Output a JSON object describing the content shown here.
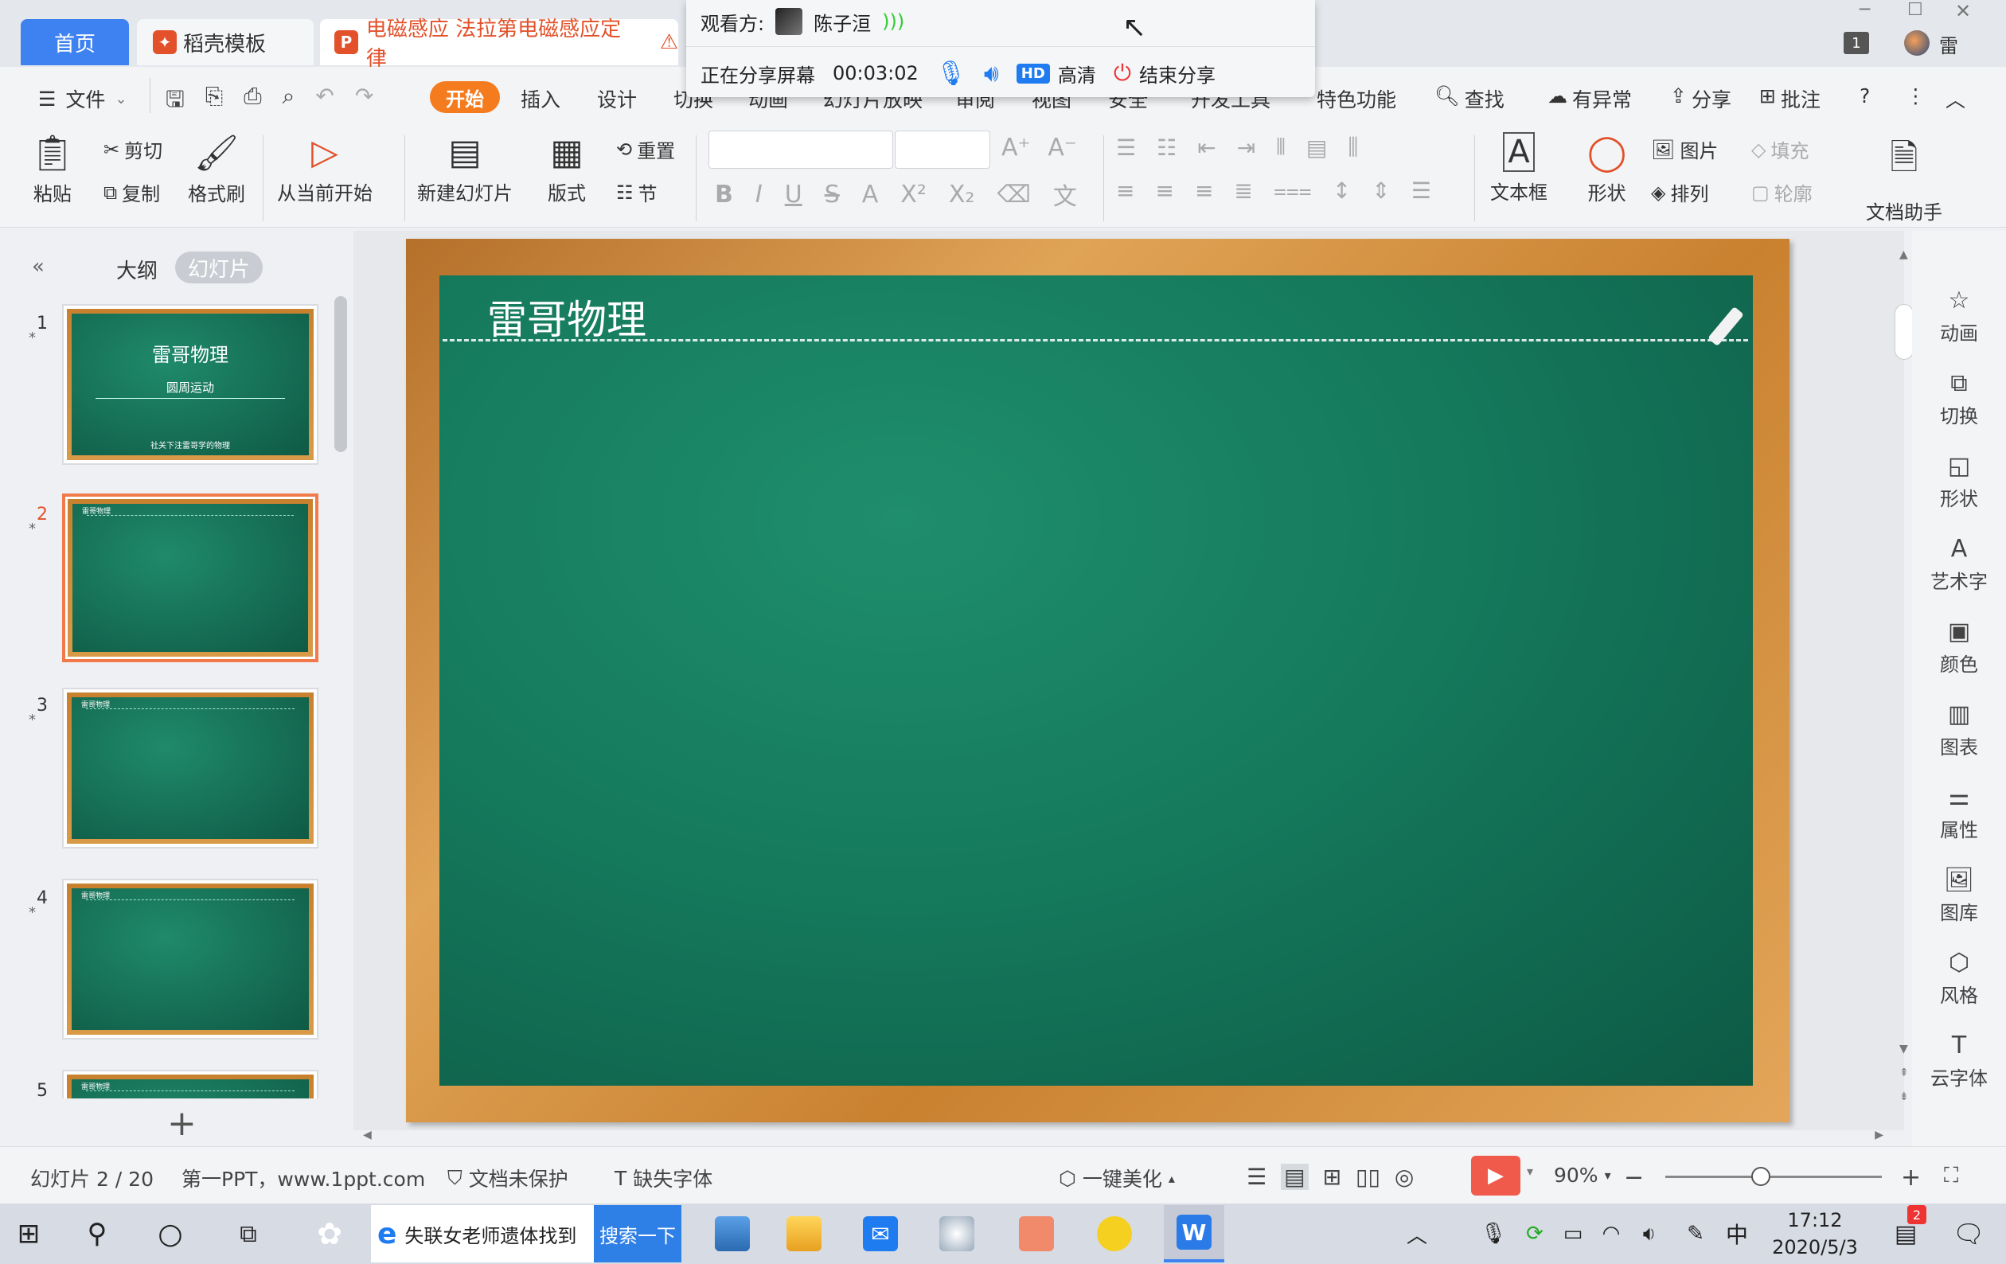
{
  "tabs": {
    "home": "首页",
    "templates": "稻壳模板",
    "doc_title": "电磁感应  法拉第电磁感应定律"
  },
  "window_controls": {
    "badge": "1",
    "user": "雷"
  },
  "share": {
    "viewer_label": "观看方:",
    "viewer_name": "陈子洹",
    "status": "正在分享屏幕",
    "timer": "00:03:02",
    "hd_badge": "HD",
    "quality": "高清",
    "end": "结束分享"
  },
  "menu": {
    "file": "文件",
    "start": "开始",
    "insert": "插入",
    "design": "设计",
    "transition": "切换",
    "animation": "动画",
    "slideshow": "幻灯片放映",
    "review": "审阅",
    "view": "视图",
    "security": "安全",
    "devtools": "开发工具",
    "special": "特色功能",
    "find": "查找",
    "exception": "有异常",
    "share": "分享",
    "comment": "批注"
  },
  "ribbon": {
    "paste": "粘贴",
    "cut": "剪切",
    "copy": "复制",
    "format_painter": "格式刷",
    "from_current": "从当前开始",
    "new_slide": "新建幻灯片",
    "layout": "版式",
    "reset": "重置",
    "section": "节",
    "textbox": "文本框",
    "shape": "形状",
    "picture": "图片",
    "arrange": "排列",
    "fill": "填充",
    "outline": "轮廓",
    "doc_assistant": "文档助手"
  },
  "panel": {
    "outline": "大纲",
    "slides": "幻灯片",
    "slide_numbers": [
      "1",
      "2",
      "3",
      "4",
      "5"
    ],
    "thumb1_title": "雷哥物理",
    "thumb1_sub": "圆周运动",
    "thumb1_footer": "社关下注雷哥学的物理",
    "thumb_title": "雷哥物理"
  },
  "slide": {
    "title": "雷哥物理"
  },
  "right_sidebar": [
    "动画",
    "切换",
    "形状",
    "艺术字",
    "颜色",
    "图表",
    "属性",
    "图库",
    "风格",
    "云字体"
  ],
  "status": {
    "slide_pos": "幻灯片 2 / 20",
    "theme": "第一PPT，www.1ppt.com",
    "protect": "文档未保护",
    "missing_font": "缺失字体",
    "beautify": "一键美化",
    "zoom": "90%"
  },
  "taskbar": {
    "search_text": "失联女老师遗体找到",
    "search_btn": "搜索一下",
    "time": "17:12",
    "date": "2020/5/3",
    "ime": "中",
    "notif_count": "2"
  },
  "colors": {
    "accent": "#f57b1f",
    "tab_blue": "#3d82f0",
    "board": "#157a5c",
    "frame": "#d08a3a"
  }
}
